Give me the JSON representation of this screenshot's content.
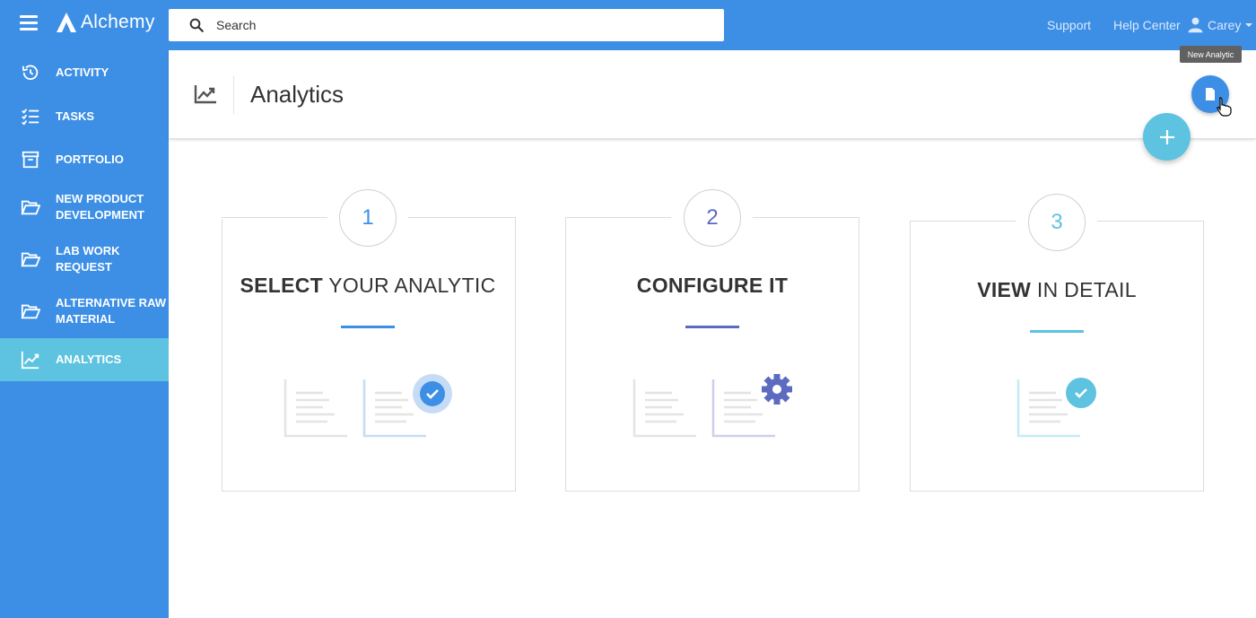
{
  "app": {
    "name": "Alchemy"
  },
  "search": {
    "placeholder": "Search"
  },
  "topnav": {
    "support": "Support",
    "help": "Help Center",
    "user": "Carey"
  },
  "sidebar": {
    "items": [
      {
        "label": "ACTIVITY",
        "icon": "history-icon"
      },
      {
        "label": "TASKS",
        "icon": "checklist-icon"
      },
      {
        "label": "PORTFOLIO",
        "icon": "archive-icon"
      },
      {
        "label": "NEW PRODUCT DEVELOPMENT",
        "icon": "folder-open-icon"
      },
      {
        "label": "LAB WORK REQUEST",
        "icon": "folder-open-icon"
      },
      {
        "label": "ALTERNATIVE RAW MATERIAL",
        "icon": "folder-open-icon"
      },
      {
        "label": "ANALYTICS",
        "icon": "chart-line-icon",
        "active": true
      }
    ]
  },
  "page": {
    "title": "Analytics"
  },
  "tooltip": "New Analytic",
  "steps": [
    {
      "number": "1",
      "bold": "SELECT",
      "rest": " YOUR ANALYTIC",
      "color": "#3d8fe6"
    },
    {
      "number": "2",
      "bold": "CONFIGURE IT",
      "rest": "",
      "color": "#5c6bc0"
    },
    {
      "number": "3",
      "bold": "VIEW",
      "rest": " IN DETAIL",
      "color": "#5ec3e0"
    }
  ],
  "colors": {
    "primary": "#3d8fe6",
    "accent": "#5ec3e0",
    "indigo": "#5c6bc0"
  }
}
